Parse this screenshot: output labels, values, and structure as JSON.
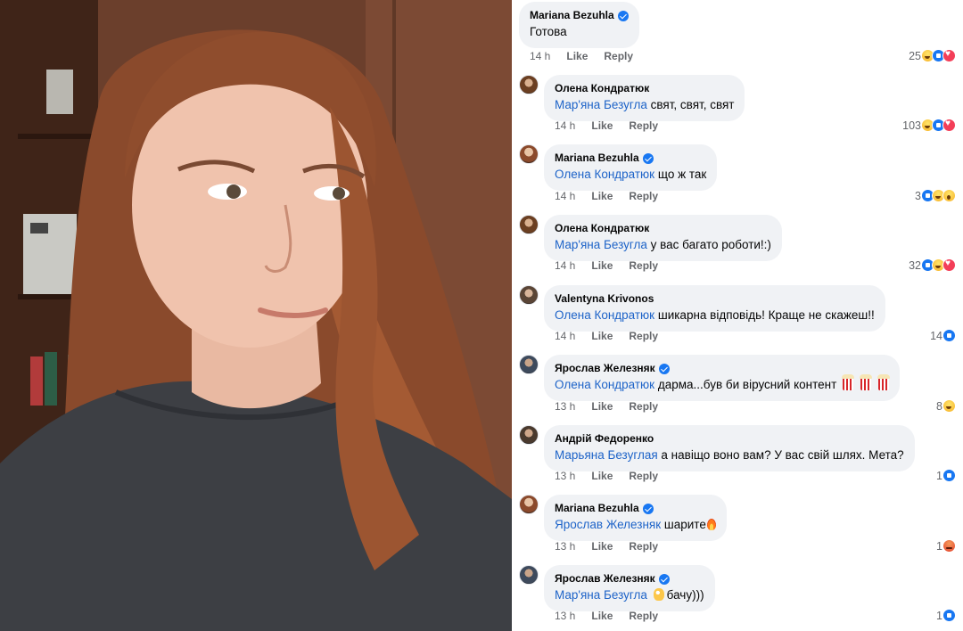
{
  "comments": [
    {
      "author": "Mariana Bezuhla",
      "verified": true,
      "mention": "",
      "text": "Готова",
      "time": "14 h",
      "like": "Like",
      "reply": "Reply",
      "count": "25",
      "reactions": [
        "haha",
        "like",
        "love"
      ]
    },
    {
      "author": "Олена Кондратюк",
      "verified": false,
      "mention": "Мар'яна Безугла",
      "text": "свят, свят, свят",
      "time": "14 h",
      "like": "Like",
      "reply": "Reply",
      "count": "103",
      "reactions": [
        "haha",
        "like",
        "love"
      ]
    },
    {
      "author": "Mariana Bezuhla",
      "verified": true,
      "mention": "Олена Кондратюк",
      "text": "що ж так",
      "time": "14 h",
      "like": "Like",
      "reply": "Reply",
      "count": "3",
      "reactions": [
        "like",
        "haha",
        "wow"
      ]
    },
    {
      "author": "Олена Кондратюк",
      "verified": false,
      "mention": "Мар'яна Безугла",
      "text": "у вас багато роботи!:)",
      "time": "14 h",
      "like": "Like",
      "reply": "Reply",
      "count": "32",
      "reactions": [
        "like",
        "haha",
        "love"
      ]
    },
    {
      "author": "Valentyna Krivonos",
      "verified": false,
      "mention": "Олена Кондратюк",
      "text": "шикарна відповідь! Краще не скажеш!!",
      "time": "14 h",
      "like": "Like",
      "reply": "Reply",
      "count": "14",
      "reactions": [
        "like"
      ]
    },
    {
      "author": "Ярослав Железняк",
      "verified": true,
      "mention": "Олена Кондратюк",
      "text": "дарма...був би вірусний контент",
      "time": "13 h",
      "like": "Like",
      "reply": "Reply",
      "count": "8",
      "reactions": [
        "haha"
      ]
    },
    {
      "author": "Андрій Федоренко",
      "verified": false,
      "mention": "Марьяна Безуглая",
      "text": "а навіщо воно вам? У вас свій шлях. Мета?",
      "time": "13 h",
      "like": "Like",
      "reply": "Reply",
      "count": "1",
      "reactions": [
        "like"
      ]
    },
    {
      "author": "Mariana Bezuhla",
      "verified": true,
      "mention": "Ярослав Железняк",
      "text": "шарите",
      "time": "13 h",
      "like": "Like",
      "reply": "Reply",
      "count": "1",
      "reactions": [
        "angry"
      ]
    },
    {
      "author": "Ярослав Железняк",
      "verified": true,
      "mention": "Мар'яна Безугла",
      "text": "бачу)))",
      "time": "13 h",
      "like": "Like",
      "reply": "Reply",
      "count": "1",
      "reactions": [
        "like"
      ]
    }
  ]
}
